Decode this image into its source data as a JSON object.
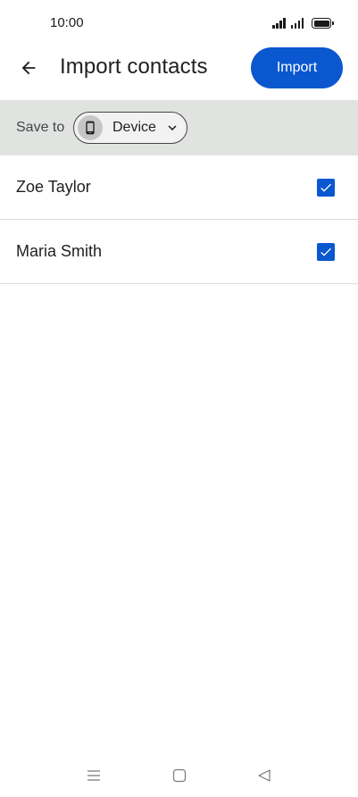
{
  "status_bar": {
    "time": "10:00",
    "icons": [
      "signal-icon",
      "signal-icon",
      "battery-icon"
    ]
  },
  "app_bar": {
    "back_icon": "arrow-back-icon",
    "title": "Import contacts",
    "import_label": "Import"
  },
  "save_to": {
    "label": "Save to",
    "account": {
      "icon": "phone-icon",
      "label": "Device",
      "dropdown_icon": "chevron-down-icon"
    }
  },
  "contacts": [
    {
      "name": "Zoe Taylor",
      "checked": true
    },
    {
      "name": "Maria Smith",
      "checked": true
    }
  ],
  "nav_bar": {
    "buttons": [
      "menu-icon",
      "home-icon",
      "back-triangle-icon"
    ]
  },
  "colors": {
    "accent": "#0b57d0",
    "save_bar_bg": "#e1e3e1",
    "divider": "#dadce0",
    "text": "#1f1f1f"
  }
}
